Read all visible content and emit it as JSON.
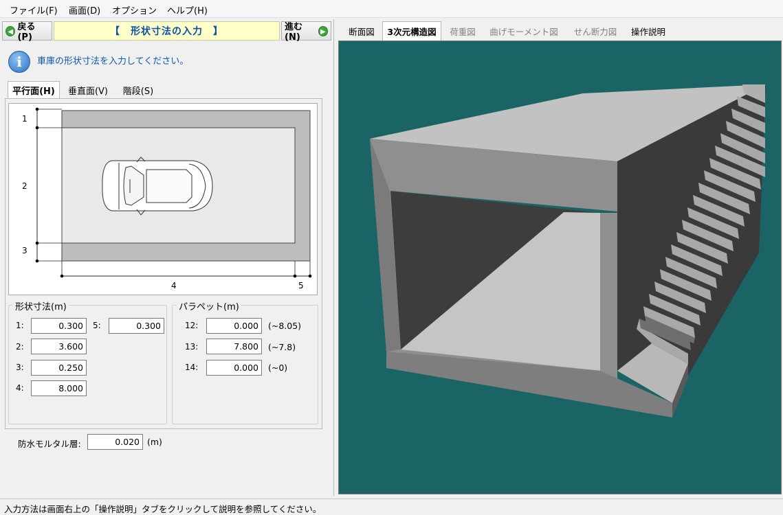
{
  "menu": {
    "file": "ファイル(F)",
    "screen": "画面(D)",
    "option": "オプション",
    "help": "ヘルプ(H)"
  },
  "nav": {
    "back": "戻る(P)",
    "forward": "進む(N)",
    "title": "【　形状寸法の入力　】"
  },
  "instruction": "車庫の形状寸法を入力してください。",
  "inner_tabs": [
    {
      "label": "平行面(H)"
    },
    {
      "label": "垂直面(V)"
    },
    {
      "label": "階段(S)"
    }
  ],
  "diagram": {
    "dim1": "1",
    "dim2": "2",
    "dim3": "3",
    "dim4": "4",
    "dim5": "5"
  },
  "shape": {
    "title": "形状寸法(m)",
    "fields": [
      {
        "label": "1:",
        "value": "0.300"
      },
      {
        "label": "2:",
        "value": "3.600"
      },
      {
        "label": "3:",
        "value": "0.250"
      },
      {
        "label": "4:",
        "value": "8.000"
      },
      {
        "label": "5:",
        "value": "0.300"
      }
    ]
  },
  "parapet": {
    "title": "パラペット(m)",
    "fields": [
      {
        "label": "12:",
        "value": "0.000",
        "range": "(~8.05)"
      },
      {
        "label": "13:",
        "value": "7.800",
        "range": "(~7.8)"
      },
      {
        "label": "14:",
        "value": "0.000",
        "range": "(~0)"
      }
    ]
  },
  "mortar": {
    "label": "防水モルタル層:",
    "value": "0.020",
    "unit": "(m)"
  },
  "right_tabs": [
    {
      "label": "断面図",
      "state": "normal"
    },
    {
      "label": "3次元構造図",
      "state": "active"
    },
    {
      "label": "荷重図",
      "state": "disabled"
    },
    {
      "label": "曲げモーメント図",
      "state": "disabled"
    },
    {
      "label": "せん断力図",
      "state": "disabled"
    },
    {
      "label": "操作説明",
      "state": "normal"
    }
  ],
  "status": "入力方法は画面右上の「操作説明」タブをクリックして説明を参照してください。",
  "colors": {
    "viewport_bg": "#1a6465",
    "title_bg": "#ffffc8",
    "title_text": "#0b4fa8",
    "instruction_text": "#0b57b4"
  }
}
